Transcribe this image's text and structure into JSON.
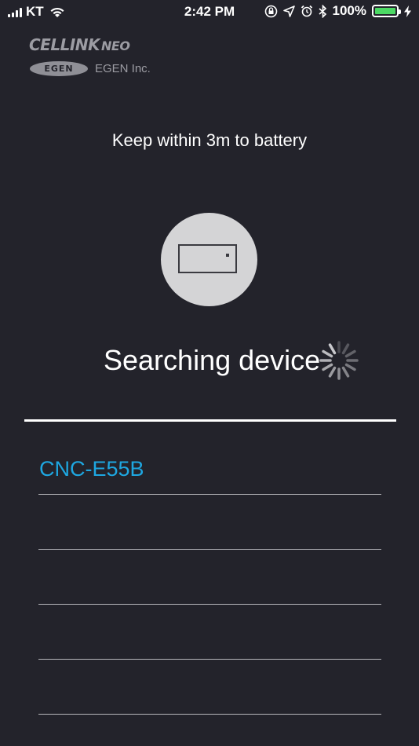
{
  "status_bar": {
    "carrier": "KT",
    "time": "2:42 PM",
    "battery_percent": "100%",
    "icons": [
      "signal-icon",
      "wifi-icon",
      "orientation-lock-icon",
      "location-icon",
      "alarm-icon",
      "bluetooth-icon",
      "battery-icon",
      "charging-icon"
    ],
    "battery_color": "#4cd964"
  },
  "logo": {
    "brand": "CELLINK",
    "brand_suffix": "NEO",
    "badge": "EGEN",
    "company": "EGEN Inc."
  },
  "hint": "Keep within 3m to battery",
  "device_icon": "battery-device-icon",
  "searching_text": "Searching device",
  "spinner_icon": "loading-spinner-icon",
  "devices": [
    {
      "label": "CNC-E55B"
    },
    {
      "label": ""
    },
    {
      "label": ""
    },
    {
      "label": ""
    },
    {
      "label": ""
    }
  ],
  "colors": {
    "background": "#23232b",
    "accent": "#1ea7e1",
    "circle": "#d4d4d6"
  }
}
